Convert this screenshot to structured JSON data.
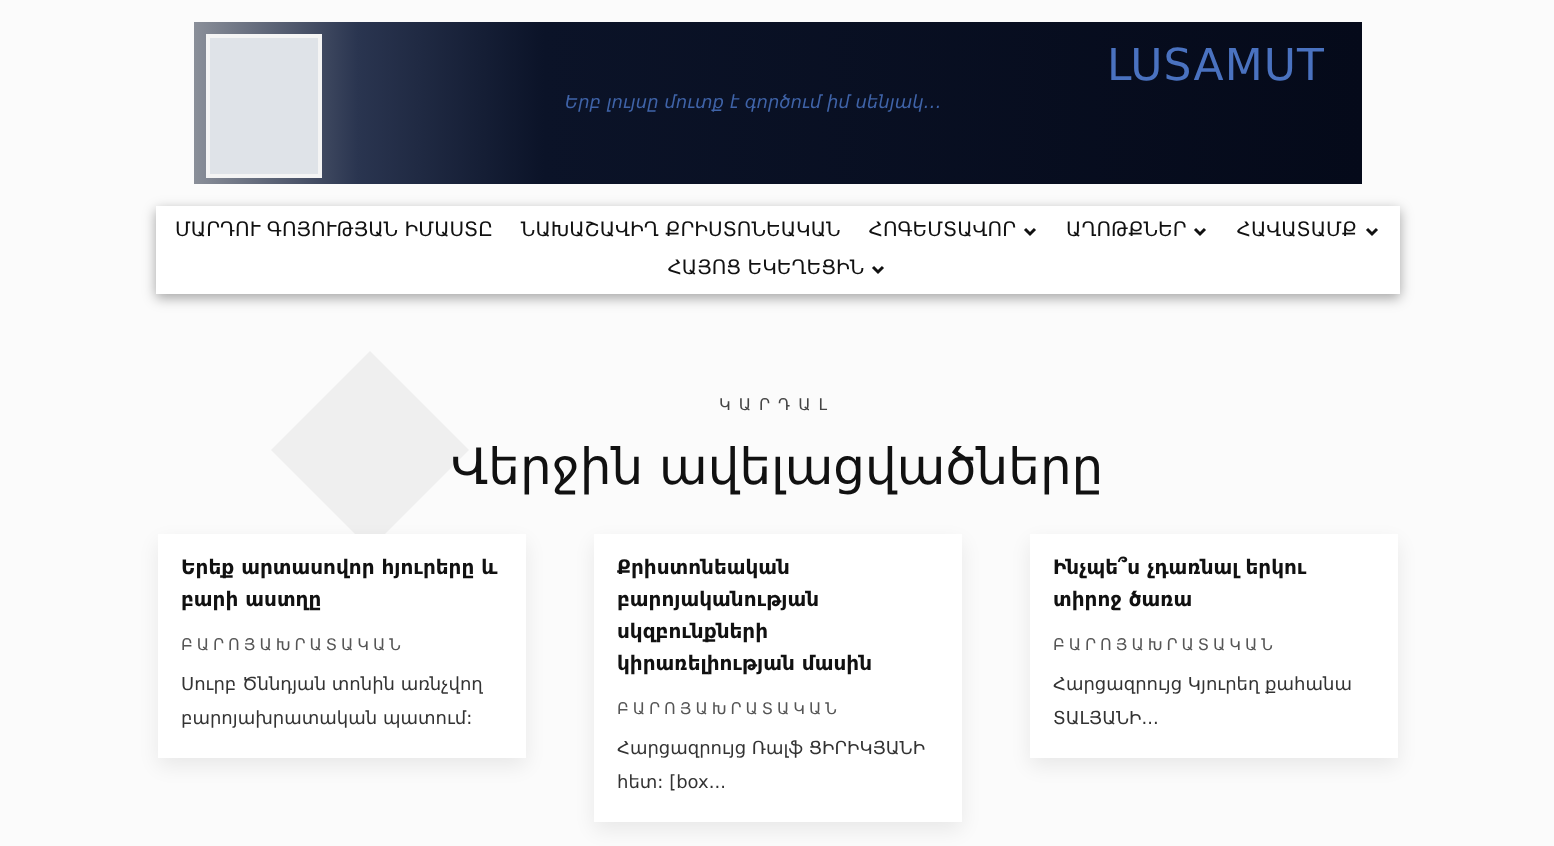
{
  "banner": {
    "logo": "LUSAMUT",
    "tagline": "Երբ լույսը մուտք է գործում իմ սենյակ…"
  },
  "nav": [
    {
      "label": "ՄԱՐԴՈՒ ԳՈՅՈՒԹՅԱՆ ԻՄԱՍՏԸ",
      "has_submenu": false
    },
    {
      "label": "ՆԱԽԱՇԱՎԻՂ ՔՐԻՍՏՈՆԵԱԿԱՆ",
      "has_submenu": false
    },
    {
      "label": "ՀՈԳԵՄՏԱՎՈՐ",
      "has_submenu": true
    },
    {
      "label": "ԱՂՈԹՔՆԵՐ",
      "has_submenu": true
    },
    {
      "label": "ՀԱՎԱՏԱՄՔ",
      "has_submenu": true
    },
    {
      "label": "ՀԱՅՈՑ ԵԿԵՂԵՑԻՆ",
      "has_submenu": true
    }
  ],
  "section": {
    "kicker": "ԿԱՐԴԱԼ",
    "title": "Վերջին ավելացվածները"
  },
  "posts": [
    {
      "title": "Երեք արտասովոր հյուրերը և բարի աստղը",
      "category": "ԲԱՐՈՅԱԽՐԱՏԱԿԱՆ",
      "excerpt": "Սուրբ Ծննդյան տոնին առնչվող բարոյախրատական պատում:"
    },
    {
      "title": "Քրիստոնեական բարոյականության սկզբունքների կիրառելիության մասին",
      "category": "ԲԱՐՈՅԱԽՐԱՏԱԿԱՆ",
      "excerpt": "Հարցազրույց Ռալֆ ՑԻՐԻԿՅԱՆԻ հետ: [box..."
    },
    {
      "title": "Ինչպե՞ս չդառնալ երկու տիրոջ ծառա",
      "category": "ԲԱՐՈՅԱԽՐԱՏԱԿԱՆ",
      "excerpt": "Հարցազրույց Կյուրեղ քահանա ՏԱԼՅԱՆԻ..."
    }
  ]
}
